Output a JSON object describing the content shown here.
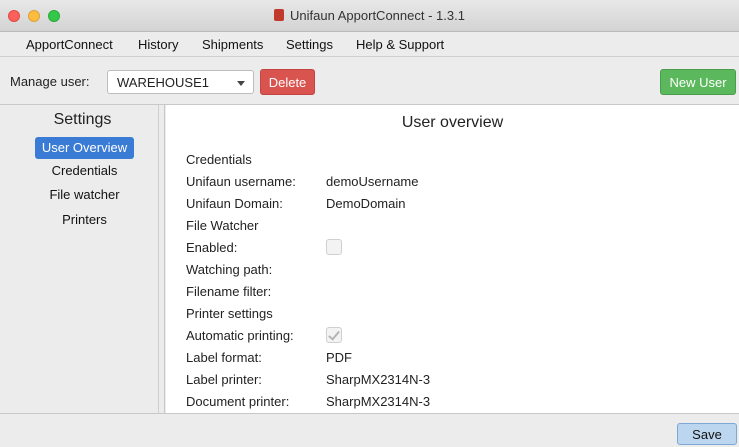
{
  "window": {
    "title": "Unifaun ApportConnect - 1.3.1"
  },
  "menu": [
    "ApportConnect",
    "History",
    "Shipments",
    "Settings",
    "Help & Support"
  ],
  "userbar": {
    "manage_label": "Manage user:",
    "selected_user": "WAREHOUSE1",
    "delete_label": "Delete",
    "new_user_label": "New User"
  },
  "sidebar": {
    "title": "Settings",
    "items": [
      {
        "label": "User Overview",
        "active": true
      },
      {
        "label": "Credentials",
        "active": false
      },
      {
        "label": "File watcher",
        "active": false
      },
      {
        "label": "Printers",
        "active": false
      }
    ]
  },
  "content": {
    "title": "User overview",
    "credentials_heading": "Credentials",
    "username_label": "Unifaun username:",
    "username_value": "demoUsername",
    "domain_label": "Unifaun Domain:",
    "domain_value": "DemoDomain",
    "filewatcher_heading": "File Watcher",
    "enabled_label": "Enabled:",
    "enabled_checked": false,
    "watching_path_label": "Watching path:",
    "filename_filter_label": "Filename filter:",
    "printer_heading": "Printer settings",
    "auto_print_label": "Automatic printing:",
    "auto_print_checked": true,
    "label_format_label": "Label format:",
    "label_format_value": "PDF",
    "label_printer_label": "Label printer:",
    "label_printer_value": "SharpMX2314N-3",
    "document_printer_label": "Document printer:",
    "document_printer_value": "SharpMX2314N-3"
  },
  "footer": {
    "save_label": "Save"
  },
  "colors": {
    "delete": "#d9534f",
    "new_user": "#5cb85c",
    "active_item": "#3a7bd5",
    "save": "#bcd6ef"
  }
}
